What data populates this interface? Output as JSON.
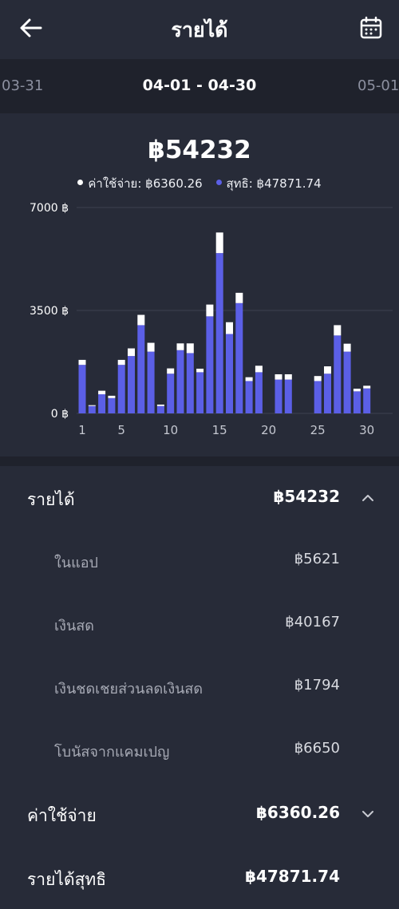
{
  "header": {
    "title": "รายได้",
    "back_icon": "arrow-left-icon",
    "calendar_icon": "calendar-icon"
  },
  "date_nav": {
    "prev": "03-31",
    "current": "04-01 - 04-30",
    "next": "05-01"
  },
  "summary": {
    "total": "฿54232",
    "legend": [
      {
        "label": "ค่าใช้จ่าย: ฿6360.26",
        "color": "#ffffff"
      },
      {
        "label": "สุทธิ: ฿47871.74",
        "color": "#5b5fe6"
      }
    ]
  },
  "chart_data": {
    "type": "bar",
    "stacked": true,
    "y_tick_labels": [
      "0 ฿",
      "3500 ฿",
      "7000 ฿"
    ],
    "y_ticks": [
      0,
      3500,
      7000
    ],
    "ylim": [
      0,
      7000
    ],
    "x_tick_labels": [
      "1",
      "5",
      "10",
      "15",
      "20",
      "25",
      "30"
    ],
    "x_ticks": [
      1,
      5,
      10,
      15,
      20,
      25,
      30
    ],
    "x": [
      1,
      2,
      3,
      4,
      5,
      6,
      7,
      8,
      9,
      10,
      11,
      12,
      13,
      14,
      15,
      16,
      17,
      18,
      19,
      20,
      21,
      22,
      23,
      24,
      25,
      26,
      27,
      28,
      29,
      30
    ],
    "series": [
      {
        "name": "สุทธิ",
        "color": "#5b5fe6",
        "values": [
          1650,
          250,
          650,
          520,
          1650,
          1950,
          3000,
          2100,
          250,
          1350,
          2150,
          2050,
          1400,
          3300,
          5450,
          2700,
          3750,
          1100,
          1400,
          0,
          1150,
          1150,
          0,
          0,
          1100,
          1350,
          2650,
          2100,
          750,
          850
        ]
      },
      {
        "name": "ค่าใช้จ่าย",
        "color": "#ffffff",
        "values": [
          170,
          30,
          120,
          80,
          170,
          260,
          350,
          300,
          50,
          180,
          230,
          330,
          120,
          400,
          700,
          400,
          350,
          130,
          220,
          0,
          180,
          180,
          0,
          0,
          170,
          250,
          350,
          270,
          90,
          90
        ]
      }
    ]
  },
  "details": {
    "income": {
      "label": "รายได้",
      "value": "฿54232",
      "chevron": "chevron-up-icon"
    },
    "items": [
      {
        "label": "ในแอป",
        "value": "฿5621"
      },
      {
        "label": "เงินสด",
        "value": "฿40167"
      },
      {
        "label": "เงินชดเชยส่วนลดเงินสด",
        "value": "฿1794"
      },
      {
        "label": "โบนัสจากแคมเปญ",
        "value": "฿6650"
      }
    ],
    "expenses": {
      "label": "ค่าใช้จ่าย",
      "value": "฿6360.26",
      "chevron": "chevron-down-icon"
    },
    "net": {
      "label": "รายได้สุทธิ",
      "value": "฿47871.74"
    }
  }
}
